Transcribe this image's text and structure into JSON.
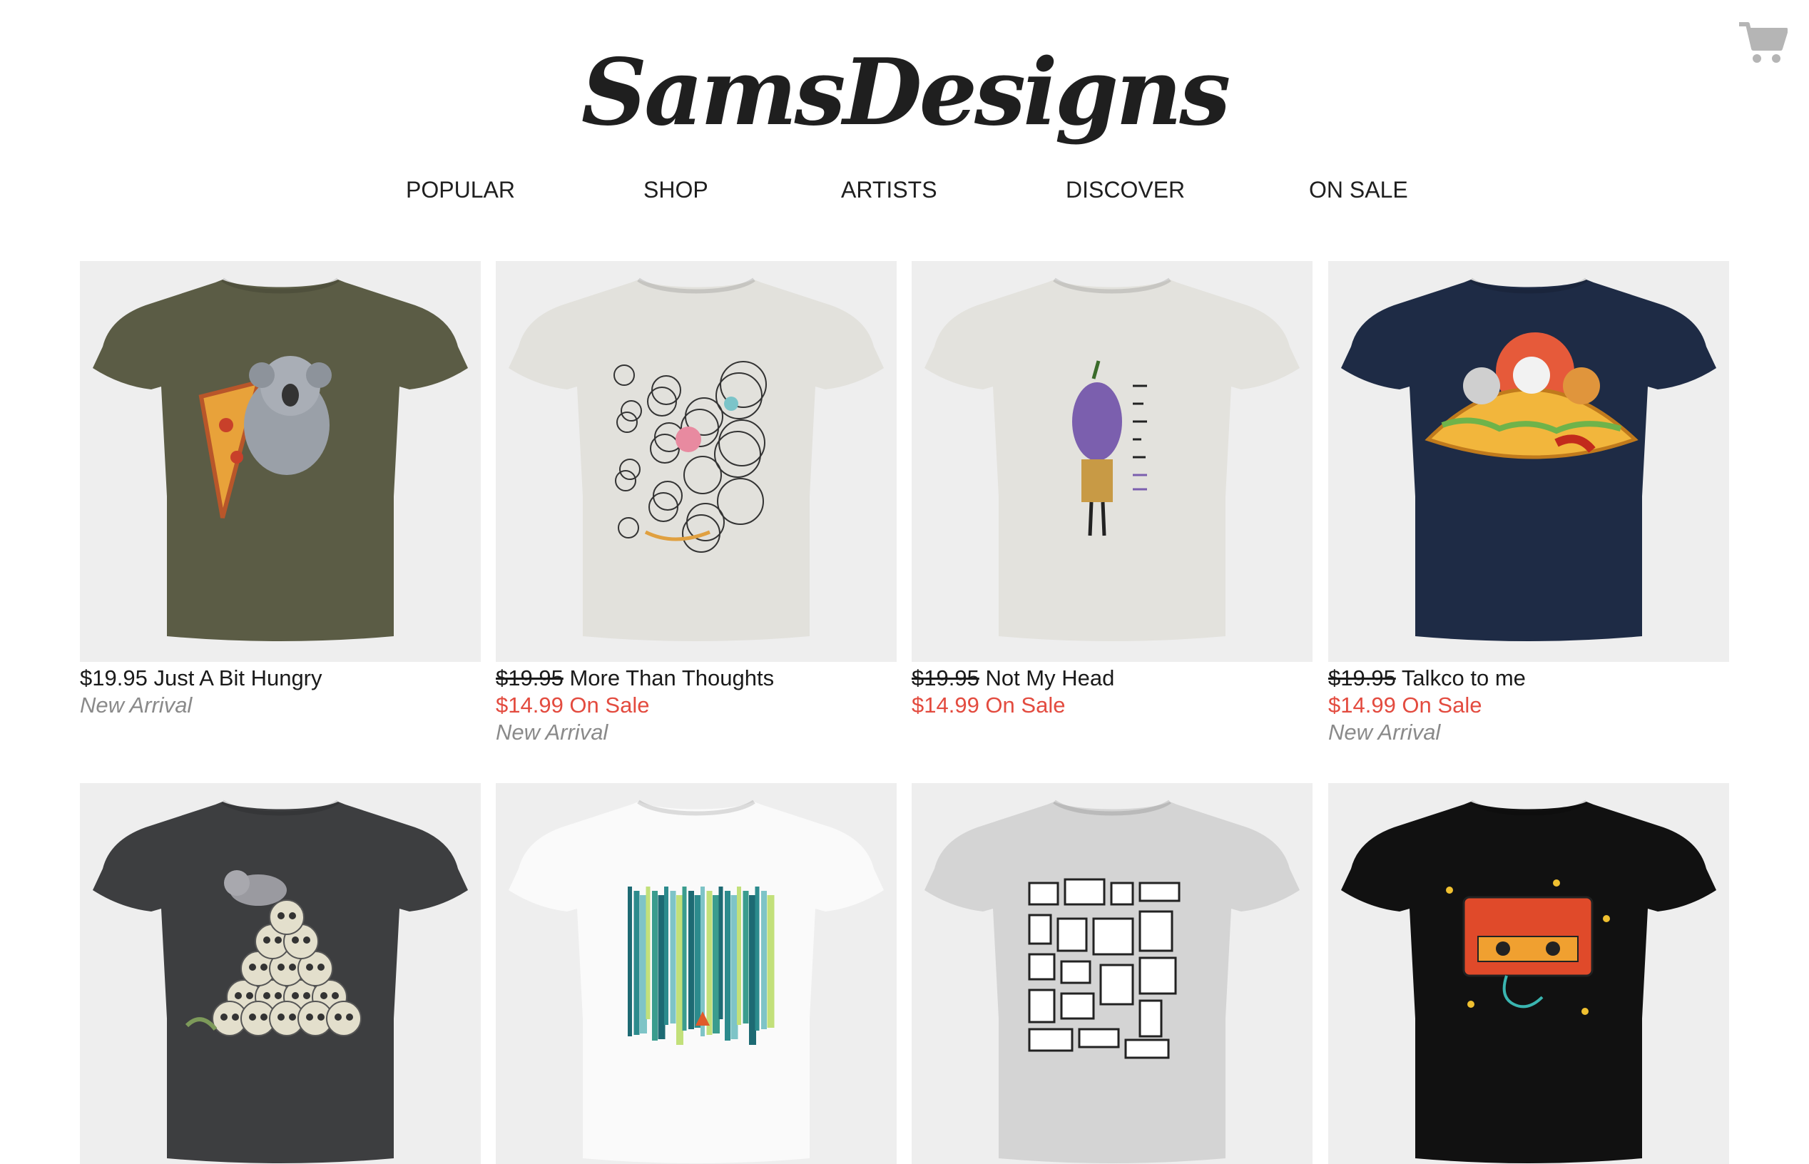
{
  "brand": {
    "logo_text": "SamsDesigns"
  },
  "header": {
    "cart_icon": "shopping-cart-icon"
  },
  "nav": [
    {
      "label": "POPULAR"
    },
    {
      "label": "SHOP"
    },
    {
      "label": "ARTISTS"
    },
    {
      "label": "DISCOVER"
    },
    {
      "label": "ON SALE"
    }
  ],
  "colors": {
    "sale_red": "#e34b3f",
    "arrival_gray": "#8a8a8a",
    "card_bg": "#eeeeee"
  },
  "products": [
    {
      "price": "$19.95",
      "name": "Just A Bit Hungry",
      "on_sale": false,
      "sale_text": "",
      "arrival": "New Arrival",
      "shirt_color": "#5b5c45",
      "design": "koala-pizza"
    },
    {
      "price": "$19.95",
      "name": "More Than Thoughts",
      "on_sale": true,
      "sale_text": "$14.99 On Sale",
      "arrival": "New Arrival",
      "shirt_color": "#e2e1dc",
      "design": "doodle"
    },
    {
      "price": "$19.95",
      "name": "Not My Head",
      "on_sale": true,
      "sale_text": "$14.99 On Sale",
      "arrival": "",
      "shirt_color": "#e3e2dd",
      "design": "eggplant"
    },
    {
      "price": "$19.95",
      "name": "Talkco to me",
      "on_sale": true,
      "sale_text": "$14.99 On Sale",
      "arrival": "New Arrival",
      "shirt_color": "#1e2b45",
      "design": "taco-cats"
    },
    {
      "price": "",
      "name": "",
      "on_sale": false,
      "sale_text": "",
      "arrival": "",
      "shirt_color": "#3d3e40",
      "design": "skull-cat"
    },
    {
      "price": "",
      "name": "",
      "on_sale": false,
      "sale_text": "",
      "arrival": "",
      "shirt_color": "#fafafa",
      "design": "forest"
    },
    {
      "price": "",
      "name": "",
      "on_sale": false,
      "sale_text": "",
      "arrival": "",
      "shirt_color": "#d4d4d4",
      "design": "frames"
    },
    {
      "price": "",
      "name": "",
      "on_sale": false,
      "sale_text": "",
      "arrival": "",
      "shirt_color": "#111111",
      "design": "cassette"
    }
  ]
}
